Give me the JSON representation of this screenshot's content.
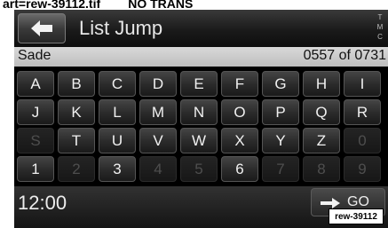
{
  "document": {
    "header_label": "art=rew-39112.tif        NO TRANS",
    "ref_tag": "rew-39112"
  },
  "titlebar": {
    "back_icon": "left-arrow-icon",
    "title": "List Jump",
    "corner_label_lines": [
      "T",
      "M",
      "C"
    ]
  },
  "status": {
    "current_name": "Sade",
    "position": "0557 of 0731"
  },
  "keyboard": {
    "keys": [
      {
        "label": "A",
        "enabled": true
      },
      {
        "label": "B",
        "enabled": true
      },
      {
        "label": "C",
        "enabled": true
      },
      {
        "label": "D",
        "enabled": true
      },
      {
        "label": "E",
        "enabled": true
      },
      {
        "label": "F",
        "enabled": true
      },
      {
        "label": "G",
        "enabled": true
      },
      {
        "label": "H",
        "enabled": true
      },
      {
        "label": "I",
        "enabled": true
      },
      {
        "label": "J",
        "enabled": true
      },
      {
        "label": "K",
        "enabled": true
      },
      {
        "label": "L",
        "enabled": true
      },
      {
        "label": "M",
        "enabled": true
      },
      {
        "label": "N",
        "enabled": true
      },
      {
        "label": "O",
        "enabled": true
      },
      {
        "label": "P",
        "enabled": true
      },
      {
        "label": "Q",
        "enabled": true
      },
      {
        "label": "R",
        "enabled": true
      },
      {
        "label": "S",
        "enabled": false
      },
      {
        "label": "T",
        "enabled": true
      },
      {
        "label": "U",
        "enabled": true
      },
      {
        "label": "V",
        "enabled": true
      },
      {
        "label": "W",
        "enabled": true
      },
      {
        "label": "X",
        "enabled": true
      },
      {
        "label": "Y",
        "enabled": true
      },
      {
        "label": "Z",
        "enabled": true
      },
      {
        "label": "0",
        "enabled": false
      },
      {
        "label": "1",
        "enabled": true
      },
      {
        "label": "2",
        "enabled": false
      },
      {
        "label": "3",
        "enabled": true
      },
      {
        "label": "4",
        "enabled": false
      },
      {
        "label": "5",
        "enabled": false
      },
      {
        "label": "6",
        "enabled": true
      },
      {
        "label": "7",
        "enabled": false
      },
      {
        "label": "8",
        "enabled": false
      },
      {
        "label": "9",
        "enabled": false
      }
    ]
  },
  "bottombar": {
    "clock": "12:00",
    "go_icon": "right-arrow-icon",
    "go_label": "GO"
  }
}
